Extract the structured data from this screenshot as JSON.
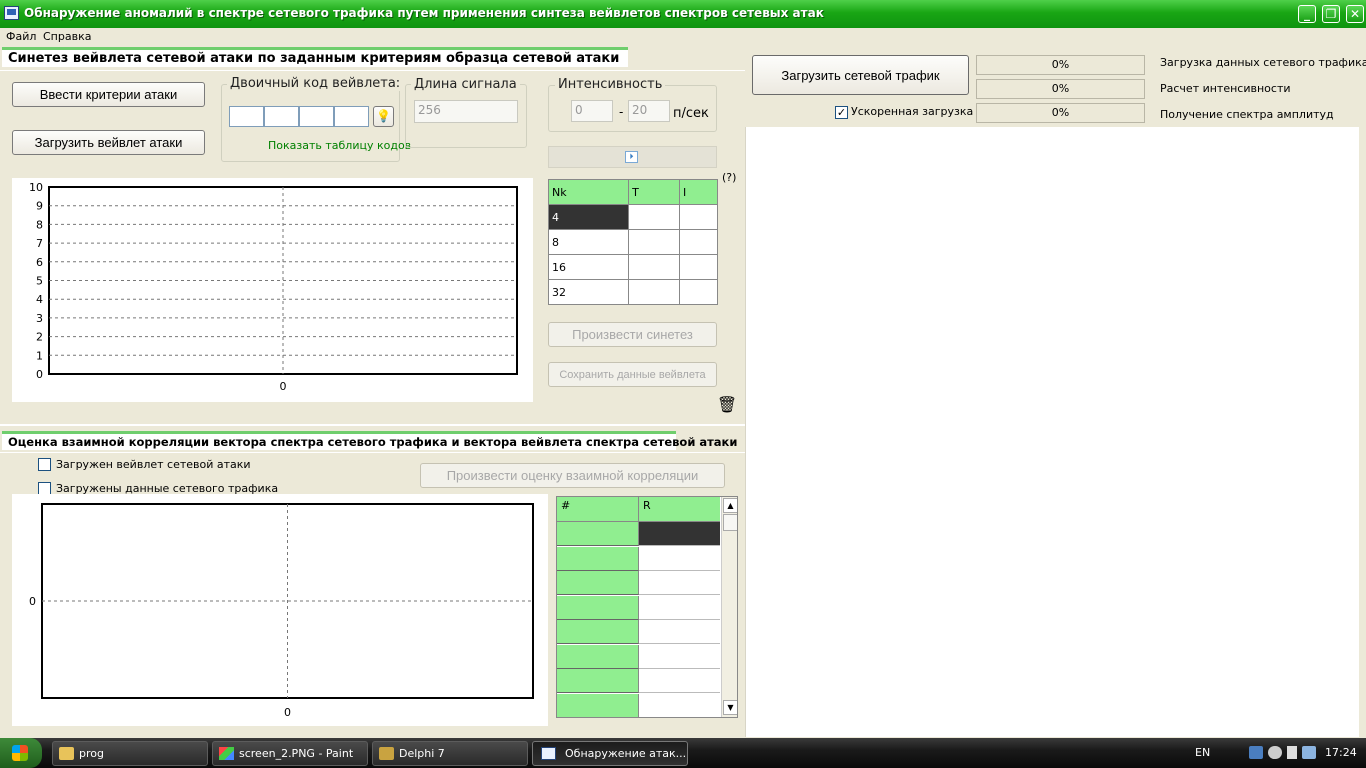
{
  "window": {
    "title": "Обнаружение аномалий в спектре сетевого трафика путем применения синтеза вейвлетов спектров сетевых атак",
    "controls": [
      "_",
      "❐",
      "✕"
    ]
  },
  "menu": [
    "Файл",
    "Справка"
  ],
  "synthesis": {
    "group_title": "Синетез вейвлета сетевой атаки по заданным критериям образца сетевой атаки",
    "enter_criteria_btn": "Ввести критерии атаки",
    "load_wavelet_btn": "Загрузить вейвлет атаки",
    "binary_code": {
      "legend": "Двоичный код вейвлета:",
      "values": [
        "",
        "",
        "",
        ""
      ],
      "show_table_link": "Показать таблицу кодов"
    },
    "signal_length": {
      "legend": "Длина сигнала",
      "value": "256"
    },
    "intensity": {
      "legend": "Интенсивность",
      "from": "0",
      "sep": "-",
      "to": "20",
      "unit": "п/сек"
    },
    "table": {
      "headers": [
        "Nk",
        "T",
        "I"
      ],
      "rows": [
        [
          "4",
          "",
          ""
        ],
        [
          "8",
          "",
          ""
        ],
        [
          "16",
          "",
          ""
        ],
        [
          "32",
          "",
          ""
        ]
      ],
      "help": "(?)"
    },
    "synthesize_btn": "Произвести синетез",
    "save_btn": "Сохранить данные вейвлета"
  },
  "correlation": {
    "group_title": "Оценка взаимной корреляции вектора спектра сетевого трафика и вектора вейвлета спектра сетевой атаки",
    "chk_wavelet": {
      "label": "Загружен вейвлет сетевой атаки",
      "checked": false
    },
    "chk_traffic": {
      "label": "Загружены данные сетевого трафика",
      "checked": false
    },
    "estimate_btn": "Произвести оценку взаимной корреляции",
    "table_headers": [
      "#",
      "R"
    ]
  },
  "traffic": {
    "load_btn": "Загрузить сетевой трафик",
    "fast_load": {
      "label": "Ускоренная загрузка",
      "checked": true
    },
    "progress": [
      {
        "value": "0%",
        "label": "Загрузка данных сетевого трафика"
      },
      {
        "value": "0%",
        "label": "Расчет интенсивности"
      },
      {
        "value": "0%",
        "label": "Получение спектра амплитуд"
      }
    ]
  },
  "taskbar": {
    "items": [
      "prog",
      "screen_2.PNG - Paint",
      "Delphi 7",
      "Обнаружение атак..."
    ],
    "lang": "EN",
    "clock": "17:24"
  },
  "chart_data": [
    {
      "type": "line",
      "title": "",
      "xlabel": "",
      "ylabel": "",
      "ylim": [
        0,
        10
      ],
      "yticks": [
        "0",
        "1",
        "2",
        "3",
        "4",
        "5",
        "6",
        "7",
        "8",
        "9",
        "10"
      ],
      "xticks": [
        "0"
      ],
      "series": [],
      "grid": true
    },
    {
      "type": "line",
      "title": "",
      "xlabel": "",
      "ylabel": "",
      "yticks": [
        "0"
      ],
      "xticks": [
        "0"
      ],
      "series": [],
      "grid": true
    }
  ]
}
